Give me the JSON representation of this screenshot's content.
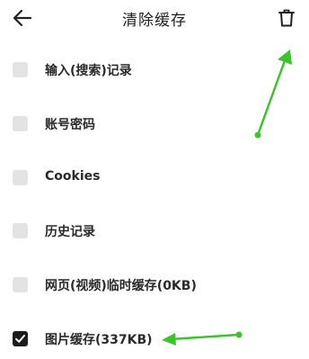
{
  "header": {
    "title": "清除缓存",
    "back_icon": "arrow-left-icon",
    "trash_icon": "trash-icon"
  },
  "items": [
    {
      "label": "输入(搜索)记录",
      "checked": false
    },
    {
      "label": "账号密码",
      "checked": false
    },
    {
      "label": "Cookies",
      "checked": false
    },
    {
      "label": "历史记录",
      "checked": false
    },
    {
      "label": "网页(视频)临时缓存(0KB)",
      "checked": false
    },
    {
      "label": "图片缓存(337KB)",
      "checked": true
    }
  ],
  "colors": {
    "annotation_arrow": "#3cc52a",
    "checkbox_unchecked": "#e3e3e3",
    "checkbox_checked": "#1c1c1c"
  }
}
